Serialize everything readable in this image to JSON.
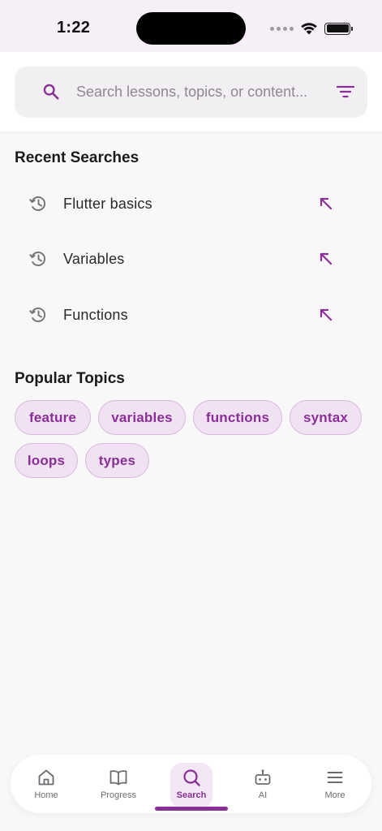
{
  "status_bar": {
    "time": "1:22"
  },
  "search": {
    "placeholder": "Search lessons, topics, or content..."
  },
  "recent": {
    "title": "Recent Searches",
    "items": [
      {
        "label": "Flutter basics"
      },
      {
        "label": "Variables"
      },
      {
        "label": "Functions"
      }
    ]
  },
  "popular": {
    "title": "Popular Topics",
    "chips": [
      "feature",
      "variables",
      "functions",
      "syntax",
      "loops",
      "types"
    ]
  },
  "nav": {
    "items": [
      {
        "label": "Home",
        "icon": "home-icon"
      },
      {
        "label": "Progress",
        "icon": "book-icon"
      },
      {
        "label": "Search",
        "icon": "search-icon"
      },
      {
        "label": "AI",
        "icon": "robot-icon"
      },
      {
        "label": "More",
        "icon": "menu-icon"
      }
    ],
    "active": "Search"
  },
  "colors": {
    "accent": "#8a2f97",
    "chip_bg": "#f0e2f2",
    "chip_border": "#d9b9dd",
    "status_bg": "#f7eff8",
    "page_bg": "#f9f8f9"
  }
}
